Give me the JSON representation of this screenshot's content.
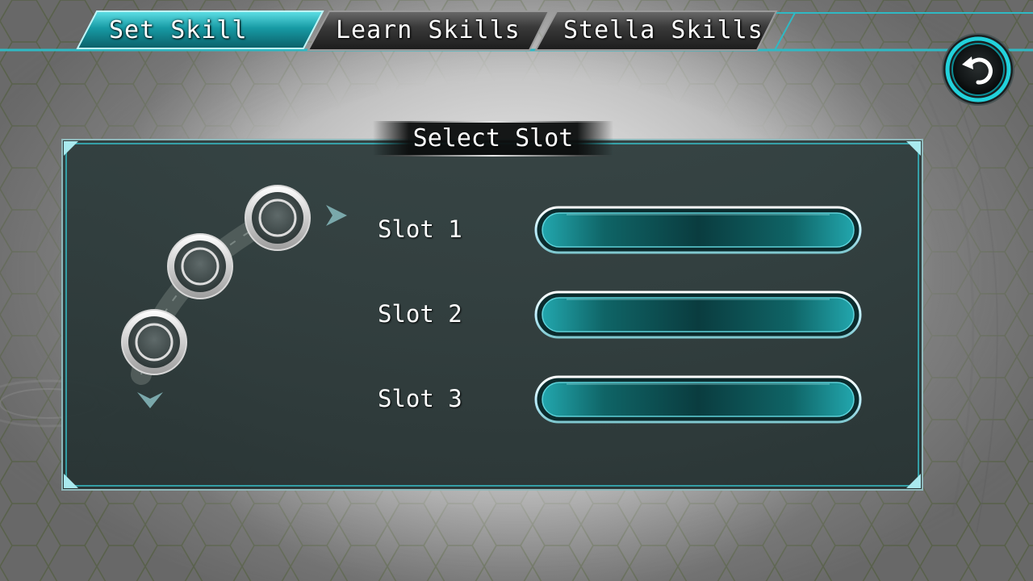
{
  "tabs": [
    {
      "label": "Set Skill",
      "active": true
    },
    {
      "label": "Learn Skills",
      "active": false
    },
    {
      "label": "Stella Skills",
      "active": false
    }
  ],
  "back_button": {
    "icon": "back-arrow-icon"
  },
  "panel": {
    "title": "Select Slot",
    "slots": [
      {
        "label": "Slot 1",
        "value": ""
      },
      {
        "label": "Slot 2",
        "value": ""
      },
      {
        "label": "Slot 3",
        "value": ""
      }
    ]
  },
  "colors": {
    "accent": "#29c6d0",
    "panel": "#2c3b3b",
    "slot_fill": "#0f4a4c"
  }
}
